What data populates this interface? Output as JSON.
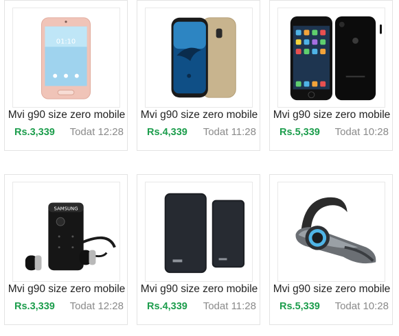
{
  "listings": [
    {
      "title": "Mvi g90 size zero mobile",
      "price": "Rs.3,339",
      "time": "Todat 12:28",
      "image": "pink-android-phone"
    },
    {
      "title": "Mvi g90 size zero mobile",
      "price": "Rs.4,339",
      "time": "Todat 11:28",
      "image": "gold-galaxy-phone"
    },
    {
      "title": "Mvi g90 size zero mobile",
      "price": "Rs.5,339",
      "time": "Todat 10:28",
      "image": "black-iphone"
    },
    {
      "title": "Mvi g90 size zero mobile",
      "price": "Rs.3,339",
      "time": "Todat 12:28",
      "image": "samsung-neckband-headset",
      "brand_text": "SAMSUNG"
    },
    {
      "title": "Mvi g90 size zero mobile",
      "price": "Rs.4,339",
      "time": "Todat 11:28",
      "image": "black-power-banks"
    },
    {
      "title": "Mvi g90 size zero mobile",
      "price": "Rs.5,339",
      "time": "Todat 10:28",
      "image": "bluetooth-earpiece"
    }
  ],
  "colors": {
    "price": "#1c9d4c",
    "time": "#8a8a8a",
    "title": "#222222",
    "border": "#e3e3e3"
  }
}
